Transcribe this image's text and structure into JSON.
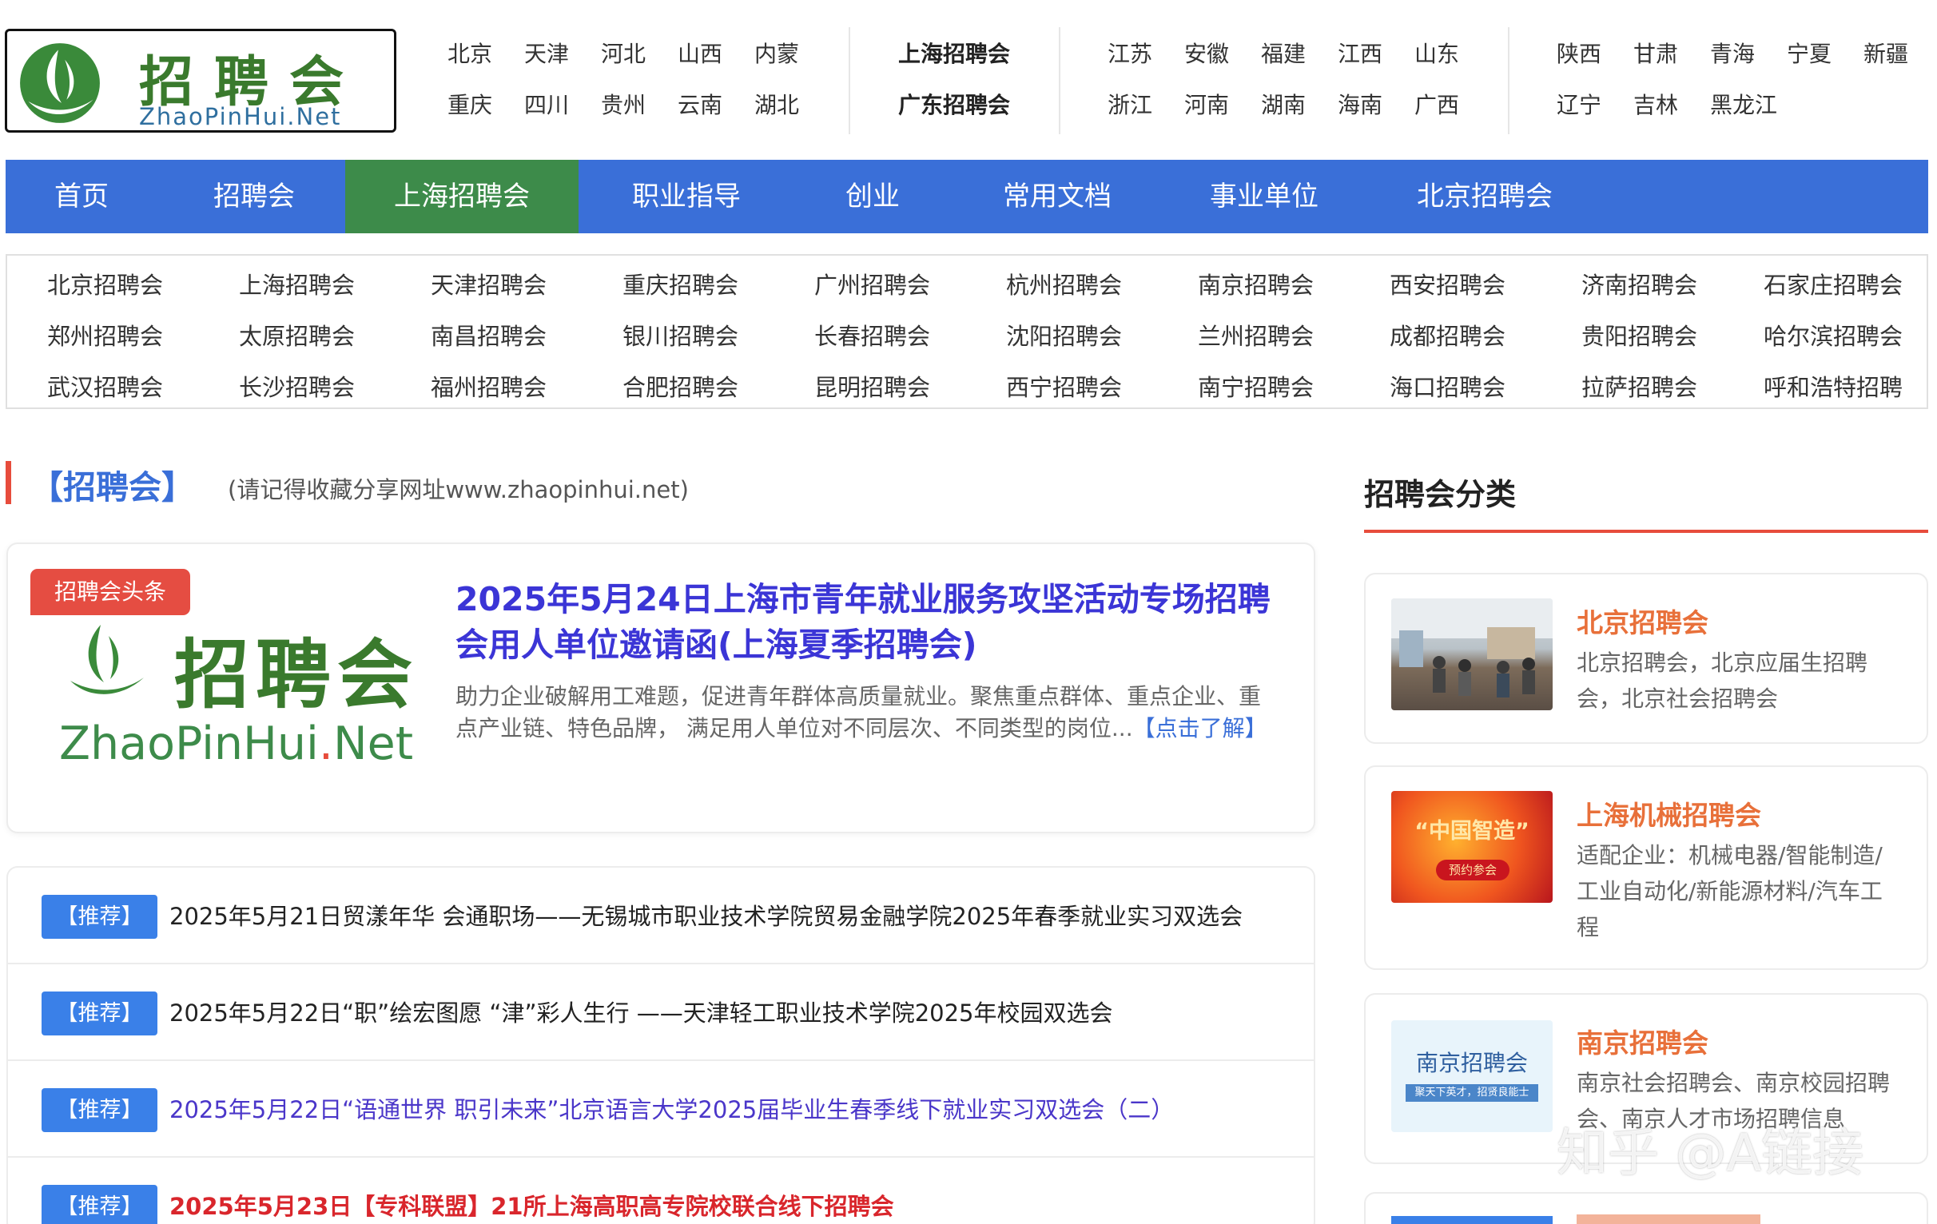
{
  "logo": {
    "cn": "招聘会",
    "en": "ZhaoPinHui.Net"
  },
  "regions": {
    "group1": [
      "北京",
      "天津",
      "河北",
      "山西",
      "内蒙",
      "重庆",
      "四川",
      "贵州",
      "云南",
      "湖北"
    ],
    "group2": [
      "上海招聘会",
      "广东招聘会"
    ],
    "group3": [
      "江苏",
      "安徽",
      "福建",
      "江西",
      "山东",
      "浙江",
      "河南",
      "湖南",
      "海南",
      "广西"
    ],
    "group4": [
      "陕西",
      "甘肃",
      "青海",
      "宁夏",
      "新疆",
      "辽宁",
      "吉林",
      "黑龙江"
    ]
  },
  "nav": {
    "items": [
      {
        "label": "首页"
      },
      {
        "label": "招聘会"
      },
      {
        "label": "上海招聘会"
      },
      {
        "label": "职业指导"
      },
      {
        "label": "创业"
      },
      {
        "label": "常用文档"
      },
      {
        "label": "事业单位"
      },
      {
        "label": "北京招聘会"
      }
    ],
    "active_index": 2,
    "colors": {
      "bar": "#3a6fd8",
      "active": "#3d8b4a"
    }
  },
  "cities": [
    "北京招聘会",
    "上海招聘会",
    "天津招聘会",
    "重庆招聘会",
    "广州招聘会",
    "杭州招聘会",
    "南京招聘会",
    "西安招聘会",
    "济南招聘会",
    "石家庄招聘会",
    "郑州招聘会",
    "太原招聘会",
    "南昌招聘会",
    "银川招聘会",
    "长春招聘会",
    "沈阳招聘会",
    "兰州招聘会",
    "成都招聘会",
    "贵阳招聘会",
    "哈尔滨招聘会",
    "武汉招聘会",
    "长沙招聘会",
    "福州招聘会",
    "合肥招聘会",
    "昆明招聘会",
    "西宁招聘会",
    "南宁招聘会",
    "海口招聘会",
    "拉萨招聘会",
    "呼和浩特招聘"
  ],
  "section": {
    "title": "【招聘会】",
    "note": "(请记得收藏分享网址www.zhaopinhui.net)"
  },
  "featured": {
    "badge": "招聘会头条",
    "logo_cn": "招聘会",
    "logo_en_a": "ZhaoPinHui",
    "logo_en_dot": ".",
    "logo_en_b": "Net",
    "title": "2025年5月24日上海市青年就业服务攻坚活动专场招聘会用人单位邀请函(上海夏季招聘会)",
    "desc": "助力企业破解用工难题，促进青年群体高质量就业。聚焦重点群体、重点企业、重点产业链、特色品牌， 满足用人单位对不同层次、不同类型的岗位...",
    "more": "【点击了解】"
  },
  "recommend": {
    "tag": "【推荐】",
    "items": [
      {
        "text": "2025年5月21日贸漾年华 会通职场——无锡城市职业技术学院贸易金融学院2025年春季就业实习双选会",
        "style": "normal"
      },
      {
        "text": "2025年5月22日“职”绘宏图愿 “津”彩人生行 ——天津轻工职业技术学院2025年校园双选会",
        "style": "normal"
      },
      {
        "text": "2025年5月22日“语通世界 职引未来”北京语言大学2025届毕业生春季线下就业实习双选会（二）",
        "style": "purple"
      },
      {
        "text": "2025年5月23日【专科联盟】21所上海高职高专院校联合线下招聘会",
        "style": "red"
      }
    ]
  },
  "sidebar": {
    "title": "招聘会分类",
    "cards": [
      {
        "name": "北京招聘会",
        "desc": "北京招聘会，北京应届生招聘会，北京社会招聘会",
        "image": "fair-photo"
      },
      {
        "name": "上海机械招聘会",
        "desc": "适配企业：机械电器/智能制造/工业自动化/新能源材料/汽车工程",
        "image": "china-smart-manufacturing-poster",
        "img_text": "“中国智造”",
        "img_btn": "预约参会"
      },
      {
        "name": "南京招聘会",
        "desc": "南京社会招聘会、南京校园招聘会、南京人才市场招聘信息",
        "image": "nanjing-banner",
        "img_text": "南京招聘会",
        "img_sub": "聚天下英才，招贤良能士"
      }
    ]
  },
  "watermark": "知乎 @A链接"
}
